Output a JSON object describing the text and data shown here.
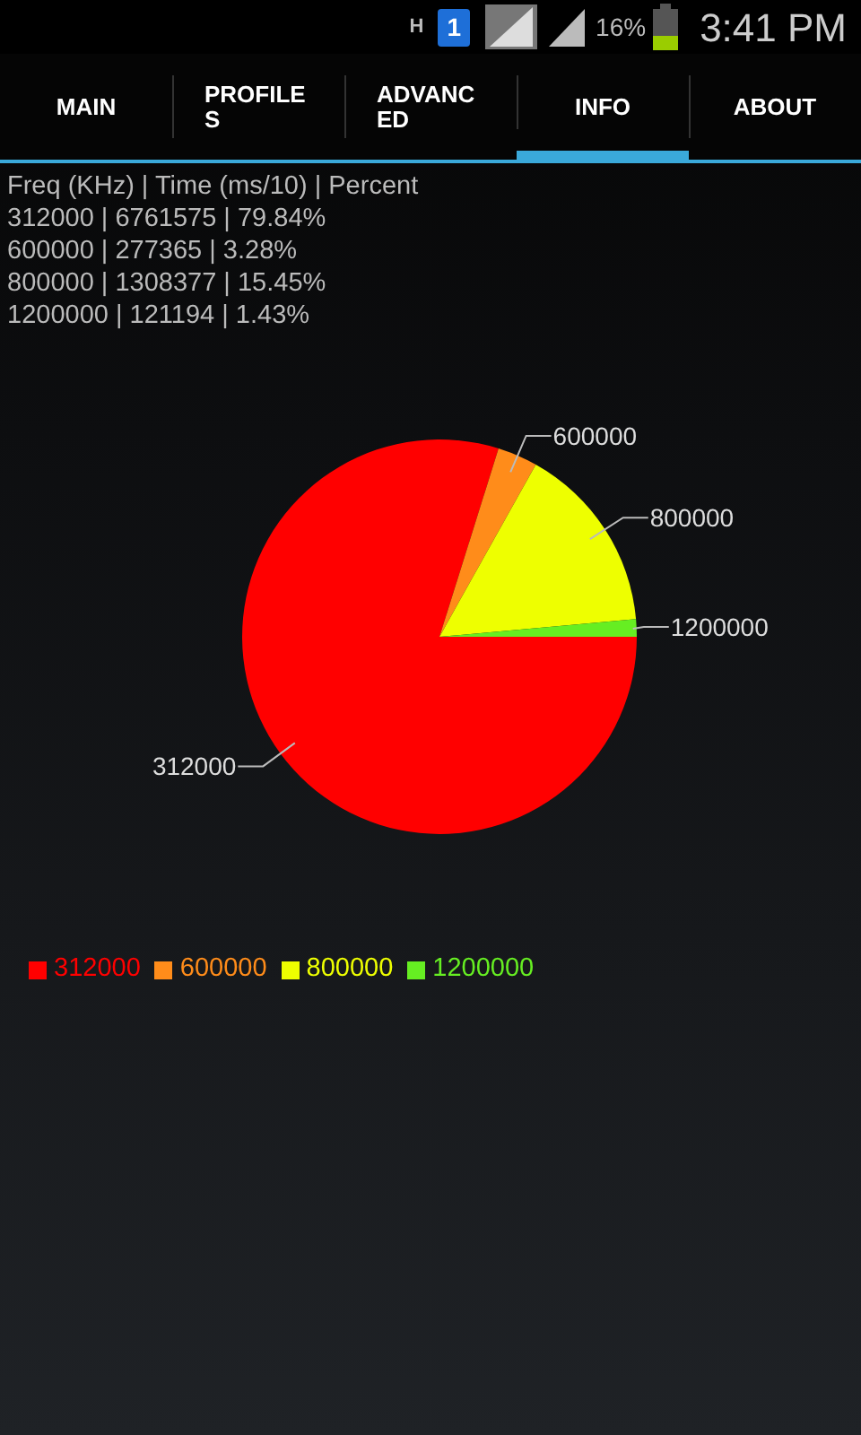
{
  "status_bar": {
    "network": "H",
    "sim": "1",
    "battery": "16%",
    "time": "3:41 PM"
  },
  "tabs": [
    {
      "label": "MAIN",
      "selected": false
    },
    {
      "label": "PROFILES",
      "selected": false
    },
    {
      "label": "ADVANCED",
      "selected": false
    },
    {
      "label": "INFO",
      "selected": true
    },
    {
      "label": "ABOUT",
      "selected": false
    }
  ],
  "info_lines": [
    "Freq (KHz) | Time (ms/10) | Percent",
    "312000 | 6761575 | 79.84%",
    "600000 | 277365 | 3.28%",
    "800000 | 1308377 | 15.45%",
    "1200000 | 121194 | 1.43%"
  ],
  "chart": {
    "chart_data": {
      "type": "pie",
      "categories": [
        "312000",
        "600000",
        "800000",
        "1200000"
      ],
      "values": [
        79.84,
        3.28,
        15.45,
        1.43
      ],
      "colors": [
        "#ff0000",
        "#ff8c1a",
        "#eeff00",
        "#66ee22"
      ]
    },
    "legend": [
      {
        "label": "312000",
        "color": "#ff0000"
      },
      {
        "label": "600000",
        "color": "#ff8c1a"
      },
      {
        "label": "800000",
        "color": "#eeff00"
      },
      {
        "label": "1200000",
        "color": "#66ee22"
      }
    ]
  }
}
